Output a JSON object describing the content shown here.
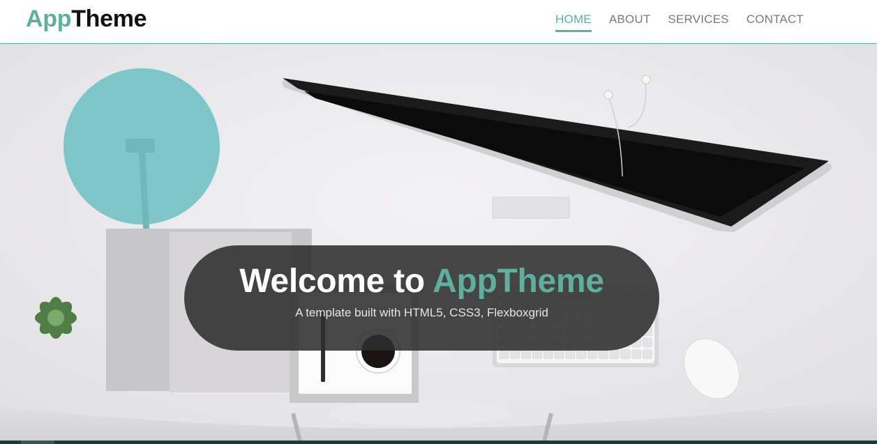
{
  "brand": {
    "part1": "App",
    "part2": "Theme"
  },
  "nav": [
    {
      "label": "HOME",
      "active": true
    },
    {
      "label": "ABOUT",
      "active": false
    },
    {
      "label": "SERVICES",
      "active": false
    },
    {
      "label": "CONTACT",
      "active": false
    }
  ],
  "hero": {
    "title_prefix": "Welcome to",
    "title_accent": "AppTheme",
    "subtitle": "A template built with HTML5, CSS3, Flexboxgrid",
    "image_subject": "desk-workspace-photo"
  },
  "colors": {
    "accent": "#5fae9e",
    "text_dark": "#111111",
    "nav_text": "#7a7a7a",
    "overlay": "#2d2d2d",
    "lamp": "#7fc6c8"
  }
}
